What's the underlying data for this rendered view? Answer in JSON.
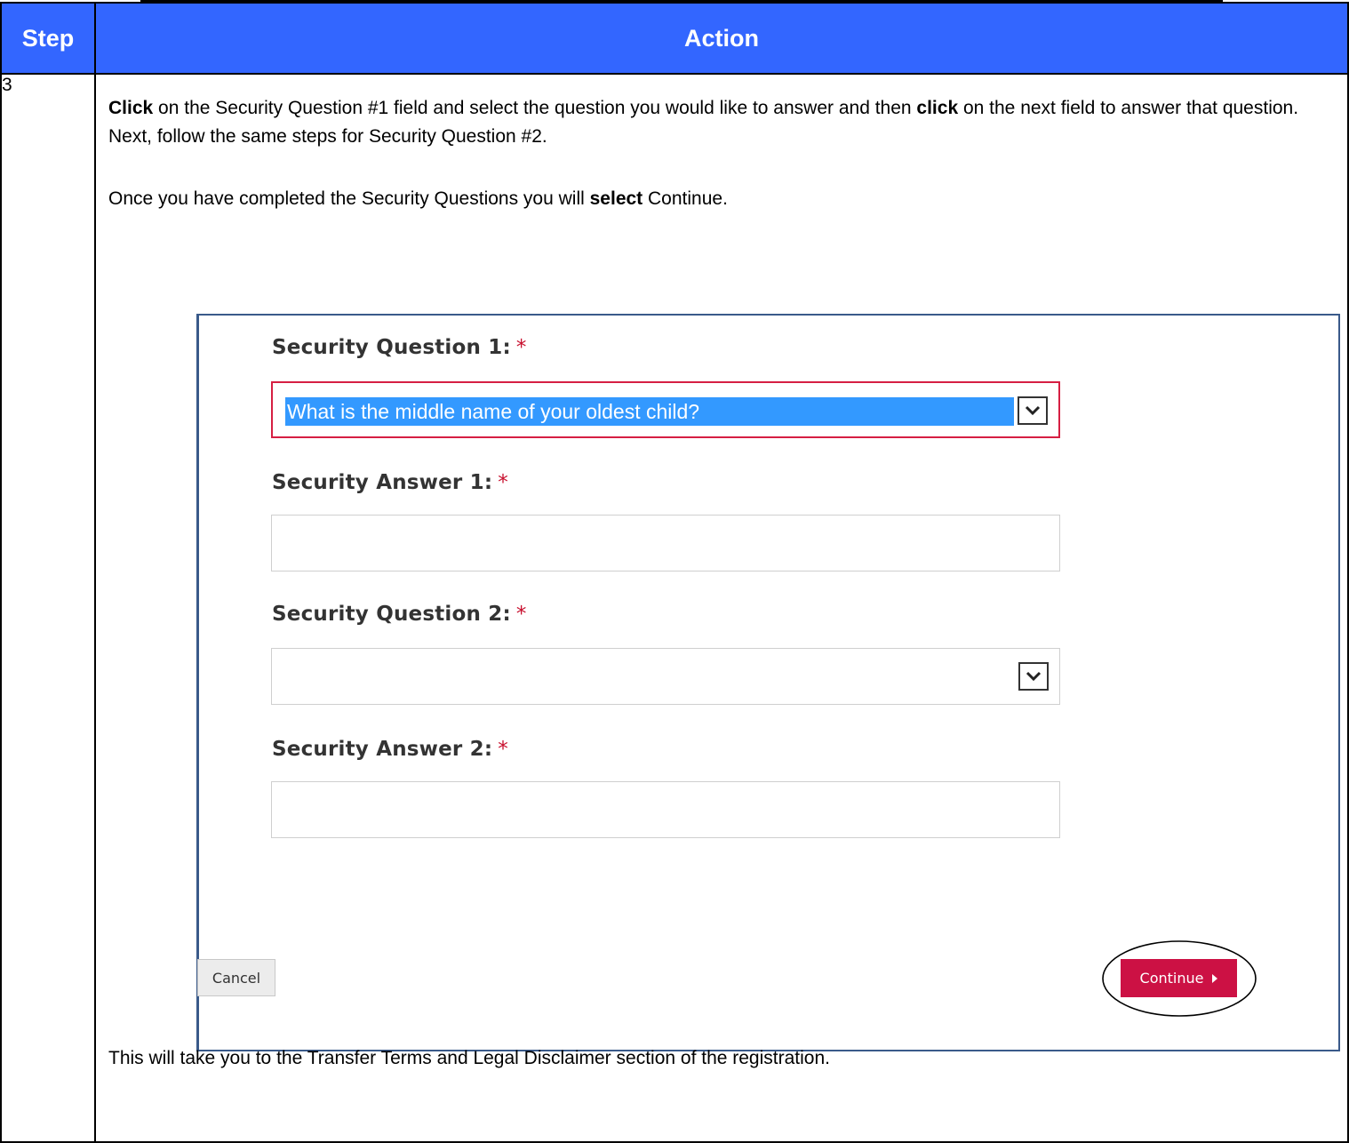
{
  "table": {
    "headers": {
      "step": "Step",
      "action": "Action"
    },
    "step_number": "3"
  },
  "instructions": {
    "p1": [
      {
        "text": "Click",
        "bold": true
      },
      {
        "text": " on the Security Question #1 field and select the question you would like to answer and then ",
        "bold": false
      },
      {
        "text": "click",
        "bold": true
      },
      {
        "text": " on the next field to answer that question.  Next, follow the same steps for Security Question #2.",
        "bold": false
      }
    ],
    "p2": [
      {
        "text": "Once you have completed the Security Questions you will ",
        "bold": false
      },
      {
        "text": "select",
        "bold": true
      },
      {
        "text": " Continue.",
        "bold": false
      }
    ],
    "p3": "This will take you to the Transfer Terms and Legal Disclaimer section of the registration."
  },
  "form": {
    "question1_label": "Security Question 1:",
    "question1_value": "What is the middle name of your oldest child?",
    "answer1_label": "Security Answer 1:",
    "answer1_value": "",
    "question2_label": "Security Question 2:",
    "question2_value": "",
    "answer2_label": "Security Answer 2:",
    "answer2_value": "",
    "required_marker": "*",
    "cancel_label": "Cancel",
    "continue_label": "Continue"
  },
  "colors": {
    "header_bg": "#3366ff",
    "accent_red": "#cc1144",
    "selection_blue": "#3399ff"
  },
  "icons": {
    "dropdown": "chevron-down-icon",
    "continue_arrow": "caret-right-icon"
  }
}
